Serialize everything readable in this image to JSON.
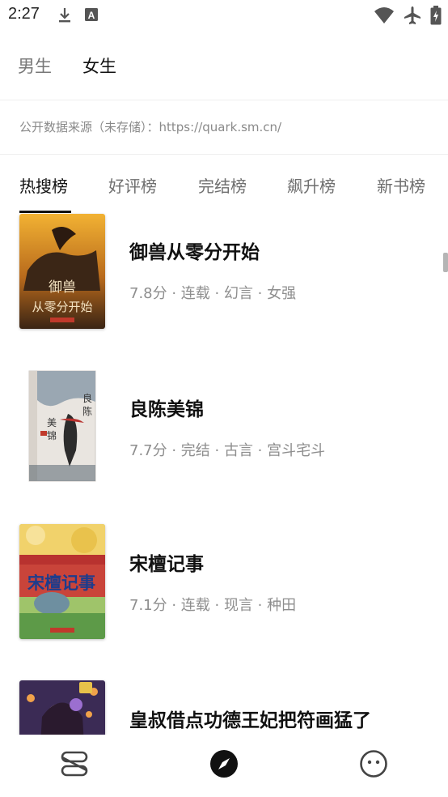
{
  "status_bar": {
    "time": "2:27",
    "left_icons": [
      "download-icon",
      "keyboard-a-icon"
    ],
    "right_icons": [
      "wifi-icon",
      "airplane-icon",
      "battery-icon"
    ]
  },
  "gender_tabs": [
    {
      "label": "男生",
      "active": false
    },
    {
      "label": "女生",
      "active": true
    }
  ],
  "source_note": "公开数据来源（未存储）：https://quark.sm.cn/",
  "rank_tabs": [
    {
      "label": "热搜榜",
      "active": true
    },
    {
      "label": "好评榜",
      "active": false
    },
    {
      "label": "完结榜",
      "active": false
    },
    {
      "label": "飙升榜",
      "active": false
    },
    {
      "label": "新书榜",
      "active": false
    }
  ],
  "books": [
    {
      "title": "御兽从零分开始",
      "meta": "7.8分 · 连载 · 幻言 · 女强",
      "cover_text": "御兽\n从零分开始"
    },
    {
      "title": "良陈美锦",
      "meta": "7.7分 · 完结 · 古言 · 宫斗宅斗",
      "cover_text": "良陈美锦"
    },
    {
      "title": "宋檀记事",
      "meta": "7.1分 · 连载 · 现言 · 种田",
      "cover_text": "宋檀记事"
    },
    {
      "title": "皇叔借点功德王妃把符画猛了",
      "meta": "",
      "cover_text": ""
    }
  ],
  "bottom_nav": [
    {
      "icon": "bookshelf-icon",
      "active": false
    },
    {
      "icon": "compass-icon",
      "active": true
    },
    {
      "icon": "profile-face-icon",
      "active": false
    }
  ]
}
